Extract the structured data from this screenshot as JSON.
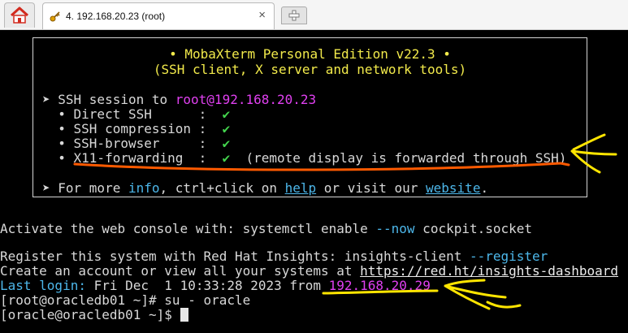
{
  "tabs": {
    "session_title": "4. 192.168.20.23 (root)",
    "close_glyph": "×",
    "home_icon": "home-icon",
    "new_tab_icon": "plus-icon"
  },
  "banner": {
    "title": "• MobaXterm Personal Edition v22.3 •",
    "subtitle": "(SSH client, X server and network tools)",
    "session_prefix": "➤ SSH session to ",
    "session_host": "root@192.168.20.23",
    "features": [
      {
        "label": "  • Direct SSH      :  ",
        "status": "✔",
        "note": ""
      },
      {
        "label": "  • SSH compression :  ",
        "status": "✔",
        "note": ""
      },
      {
        "label": "  • SSH-browser     :  ",
        "status": "✔",
        "note": ""
      },
      {
        "label": "  • X11-forwarding  :  ",
        "status": "✔",
        "note": "  (remote display is forwarded through SSH)"
      }
    ],
    "more_prefix": "➤ For more ",
    "info_label": "info",
    "more_mid": ", ctrl+click on ",
    "help_label": "help",
    "more_mid2": " or visit our ",
    "website_label": "website",
    "more_end": "."
  },
  "console": {
    "activate_prefix": "Activate the web console with: systemctl enable ",
    "activate_flag": "--now",
    "activate_suffix": " cockpit.socket",
    "register_prefix": "Register this system with Red Hat Insights: insights-client ",
    "register_flag": "--register",
    "account_prefix": "Create an account or view all your systems at ",
    "account_url": "https://red.ht/insights-dashboard",
    "last_login_label": "Last login:",
    "last_login_value": " Fri Dec  1 10:33:28 2023 from ",
    "last_login_ip": "192.168.20.29",
    "prompt1": "[root@oracledb01 ~]# ",
    "command1": "su - oracle",
    "prompt2": "[oracle@oracledb01 ~]$ "
  },
  "colors": {
    "background": "#000000",
    "text": "#d8d8d8",
    "yellow": "#f2ea4b",
    "magenta": "#e040f0",
    "green": "#43d34d",
    "blue": "#4db7ea",
    "annotation_orange": "#ff5a00",
    "annotation_yellow": "#ffe500"
  }
}
